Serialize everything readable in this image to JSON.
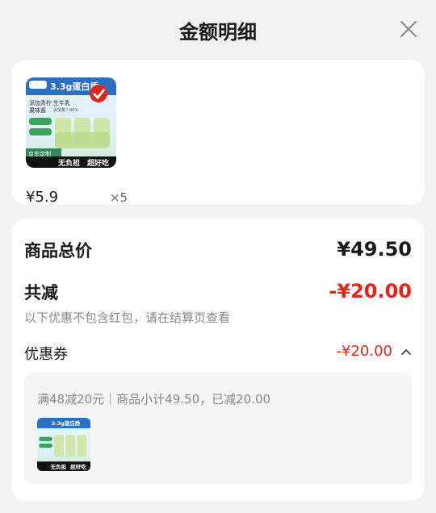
{
  "header": {
    "title": "金额明细",
    "close_icon": "close-icon"
  },
  "items": [
    {
      "price": "¥5.9",
      "quantity": "×5",
      "image": {
        "banner": "3.3g蛋白质",
        "lines": [
          "添加青柠",
          "果味酱",
          "生牛乳",
          "添加量＞90%"
        ],
        "tag": "京东定制",
        "slogan": [
          "无负担",
          "超好吃"
        ]
      }
    }
  ],
  "summary": {
    "total_label": "商品总价",
    "total_value": "¥49.50",
    "discount_label": "共减",
    "discount_value": "-¥20.00",
    "discount_note": "以下优惠不包含红包，请在结算页查看",
    "coupon_label": "优惠券",
    "coupon_value": "-¥20.00",
    "coupon_detail": "满48减20元｜商品小计49.50，已减20.00"
  },
  "colors": {
    "accent": "#e1251b",
    "background": "#f2f2f2",
    "card": "#ffffff"
  }
}
